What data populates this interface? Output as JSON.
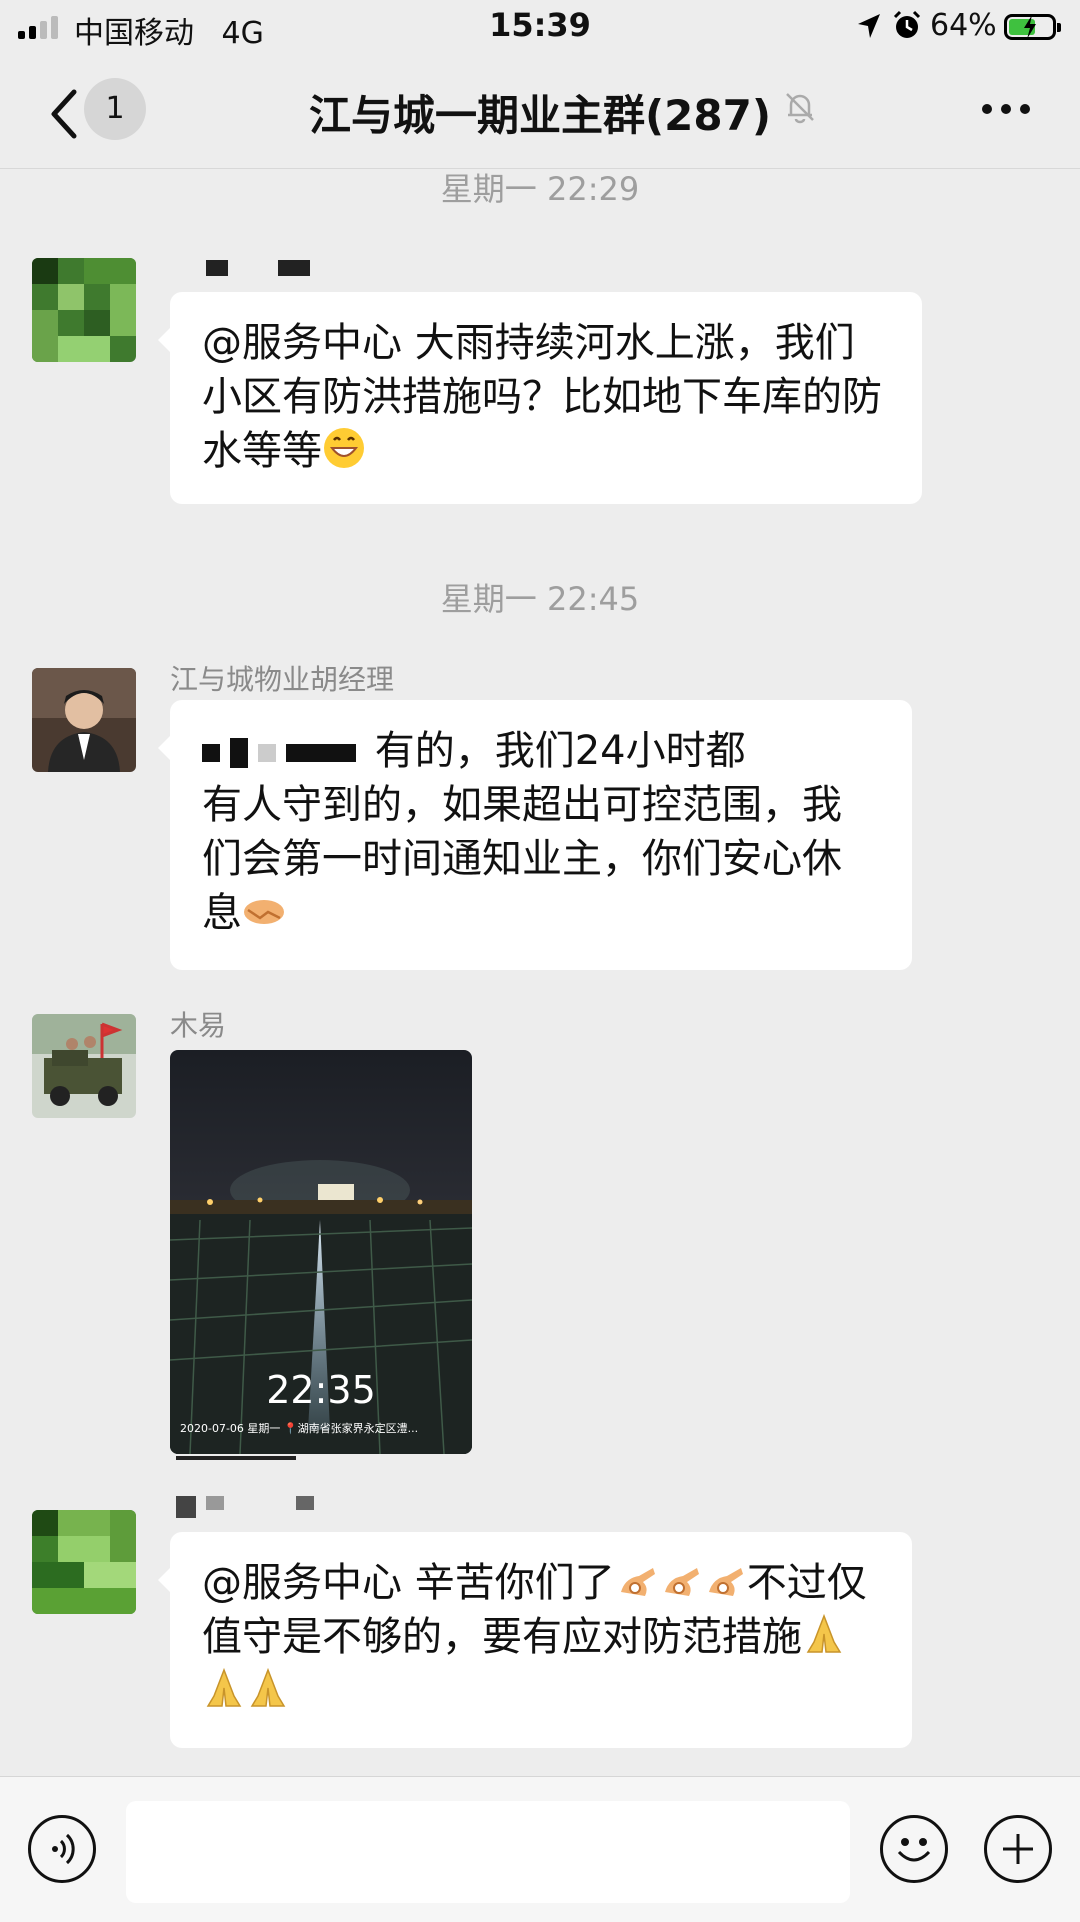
{
  "status_bar": {
    "carrier": "中国移动",
    "network": "4G",
    "time": "15:39",
    "battery": "64%",
    "battery_level": 0.64
  },
  "nav": {
    "unread_count": "1",
    "title": "江与城一期业主群(287)"
  },
  "messages": {
    "ts1": "星期一 22:29",
    "msg1": "@服务中心 大雨持续河水上涨，我们小区有防洪措施吗？比如地下车库的防水等等",
    "ts2": "星期一 22:45",
    "sender2": "江与城物业胡经理",
    "msg2_a": "有的，我们24小时都",
    "msg2_b": "有人守到的，如果超出可控范围，我们会第一时间通知业主，你们安心休息",
    "sender3": "木易",
    "video_time": "22:35",
    "video_caption": "2020-07-06 星期一 📍湖南省张家界永定区澧...",
    "msg4": "@服务中心 辛苦你们了",
    "msg4_b": "不过仅值守是不够的，要有应对防范措施"
  },
  "colors": {
    "background": "#ededed",
    "bubble": "#ffffff",
    "battery_fill": "#3fc13f"
  }
}
